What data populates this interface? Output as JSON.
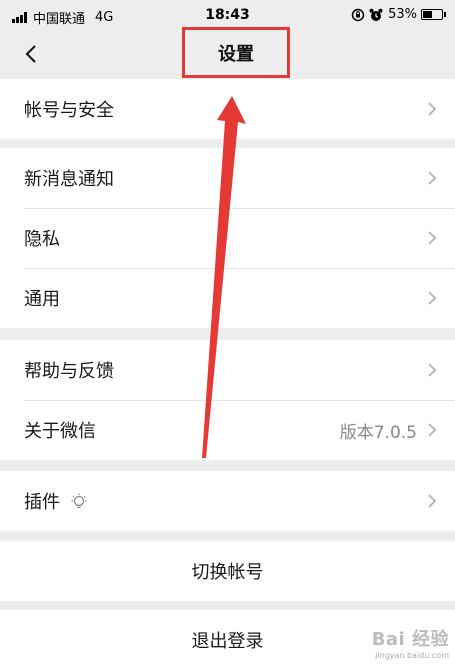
{
  "status_bar": {
    "carrier": "中国联通",
    "network": "4G",
    "time": "18:43",
    "battery_percent": "53%",
    "battery_level": 0.53
  },
  "nav": {
    "title": "设置",
    "back_icon": "chevron-left-icon",
    "highlight_color": "#e53935"
  },
  "groups": [
    {
      "items": [
        {
          "label": "帐号与安全",
          "value": ""
        }
      ]
    },
    {
      "items": [
        {
          "label": "新消息通知",
          "value": ""
        },
        {
          "label": "隐私",
          "value": ""
        },
        {
          "label": "通用",
          "value": ""
        }
      ]
    },
    {
      "items": [
        {
          "label": "帮助与反馈",
          "value": ""
        },
        {
          "label": "关于微信",
          "value": "版本7.0.5"
        }
      ]
    },
    {
      "items": [
        {
          "label": "插件",
          "value": "",
          "icon": "lightbulb-icon"
        }
      ]
    }
  ],
  "actions": {
    "switch_account": "切换帐号",
    "logout": "退出登录"
  },
  "watermark": {
    "main": "Bai 经验",
    "sub": "jingyan.baidu.com"
  },
  "colors": {
    "background": "#ededed",
    "cell": "#ffffff",
    "annotation_red": "#e53935"
  }
}
